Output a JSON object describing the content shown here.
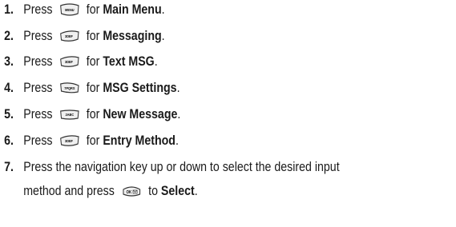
{
  "steps": [
    {
      "num": "1.",
      "prefix": "Press",
      "key": "MENU",
      "mid": "for",
      "target": "Main Menu",
      "end": "."
    },
    {
      "num": "2.",
      "prefix": "Press",
      "key": "3DEF",
      "mid": "for",
      "target": "Messaging",
      "end": "."
    },
    {
      "num": "3.",
      "prefix": "Press",
      "key": "3DEF",
      "mid": "for",
      "target": "Text MSG",
      "end": "."
    },
    {
      "num": "4.",
      "prefix": "Press",
      "key": "7PQRS",
      "mid": "for",
      "target": "MSG Settings",
      "end": "."
    },
    {
      "num": "5.",
      "prefix": "Press",
      "key": "2ABC",
      "mid": "for",
      "target": "New Message",
      "end": "."
    },
    {
      "num": "6.",
      "prefix": "Press",
      "key": "3DEF",
      "mid": "for",
      "target": "Entry Method",
      "end": "."
    },
    {
      "num": "7.",
      "line1": "Press the navigation key up or down to select the desired input",
      "prefix": "method and press",
      "key": "OK",
      "mid": "to",
      "target": "Select",
      "end": "."
    }
  ]
}
